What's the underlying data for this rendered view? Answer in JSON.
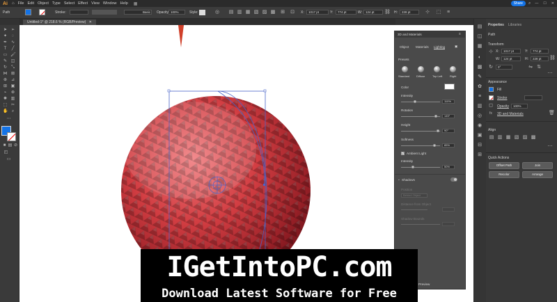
{
  "menubar": {
    "items": [
      "File",
      "Edit",
      "Object",
      "Type",
      "Select",
      "Effect",
      "View",
      "Window",
      "Help"
    ],
    "share_label": "Share"
  },
  "control_bar": {
    "path_label": "Path",
    "stroke_label": "Stroke:",
    "stroke_style": "Basic",
    "opacity_label": "Opacity:",
    "opacity_value": "100%",
    "style_label": "Style:",
    "x_value": "1017 pt",
    "y_value": "774 pt",
    "w_value": "124 pt",
    "h_value": "228 pt"
  },
  "document_tab": {
    "title": "Untitled-1* @ 218.6 % (RGB/Preview)"
  },
  "panel_3d": {
    "title": "3D and Materials",
    "tabs": [
      "Object",
      "Materials",
      "Lighting"
    ],
    "presets_label": "Presets",
    "presets": [
      "Standard",
      "Diffuse",
      "Top Left",
      "Right"
    ],
    "color_label": "Color",
    "intensity_label": "Intensity",
    "intensity_value": "110%",
    "intensity_fraction": 0.35,
    "rotation_label": "Rotation",
    "rotation_value": "145°",
    "rotation_fraction": 0.9,
    "height_label": "Height",
    "height_value": "90°",
    "height_fraction": 0.95,
    "softness_label": "Softness",
    "softness_value": "85%",
    "softness_fraction": 0.85,
    "ambient_label": "Ambient Light",
    "ambient_intensity_label": "Intensity",
    "ambient_intensity_value": "50%",
    "ambient_fraction": 0.3,
    "shadows_label": "Shadows",
    "position_label": "Position",
    "position_value": "Behind Object",
    "distance_label": "Distance from Object",
    "shadow_bounds_label": "Shadow Bounds",
    "preview_label": "Preview"
  },
  "properties": {
    "tabs": [
      "Properties",
      "Libraries"
    ],
    "path_label": "Path",
    "transform_label": "Transform",
    "x_value": "1017 pt",
    "y_value": "774 pt",
    "w_value": "124 pt",
    "h_value": "228 pt",
    "angle_value": "0°",
    "appearance_label": "Appearance",
    "fill_label": "Fill",
    "stroke_label": "Stroke",
    "opacity_label": "Opacity",
    "opacity_value": "100%",
    "fx_label": "3D and Materials",
    "align_label": "Align",
    "quick_actions_label": "Quick Actions",
    "offset_path_label": "Offset Path",
    "join_label": "Join",
    "recolor_label": "Recolor",
    "arrange_label": "Arrange"
  },
  "watermark": {
    "line1": "IGetIntoPC.com",
    "line2": "Download Latest Software for Free"
  },
  "colors": {
    "accent": "#1473e6",
    "sphere_base": "#c8333a",
    "selection": "#4a64c8"
  }
}
